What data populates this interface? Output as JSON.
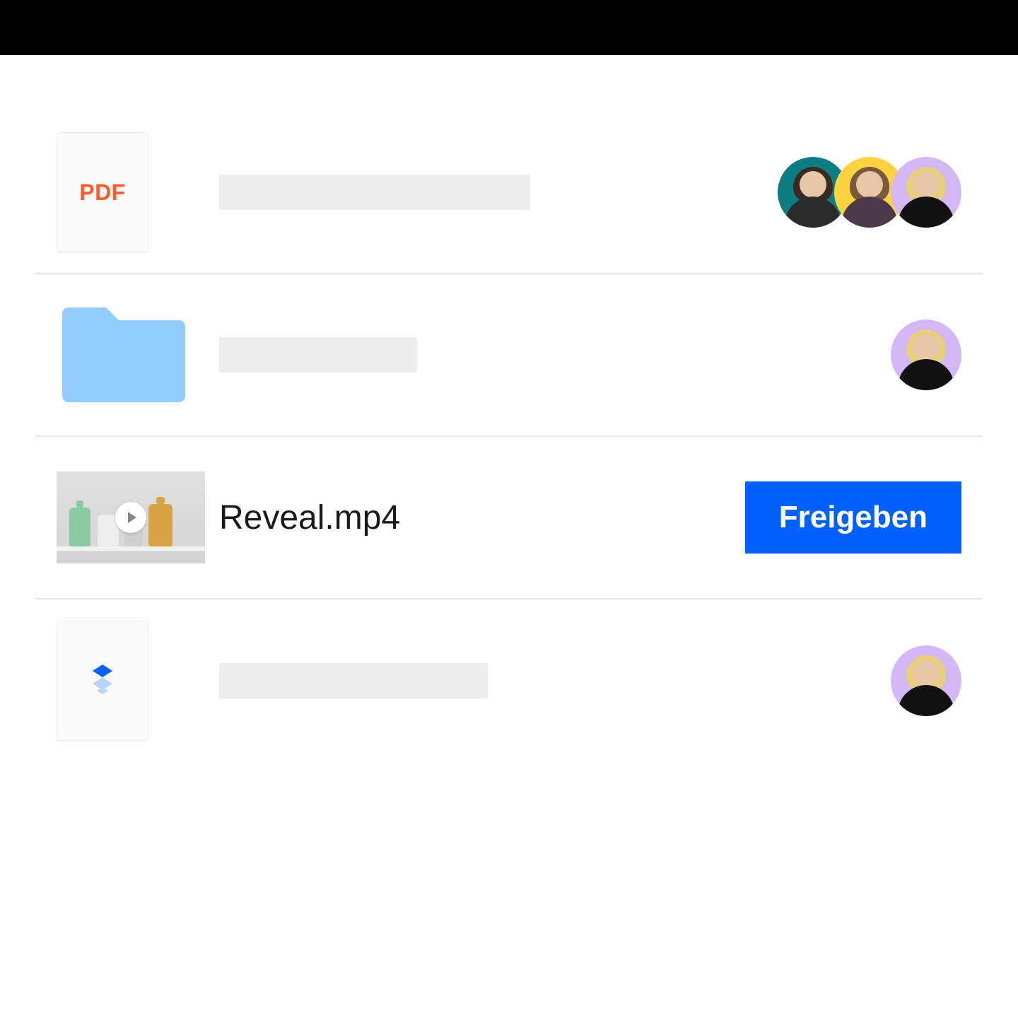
{
  "colors": {
    "accent": "#0061fe",
    "pdf_label": "#ff5b2e",
    "folder": "#92ccff",
    "avatar_teal": "#0d7d84",
    "avatar_yellow": "#ffd23f",
    "avatar_lilac": "#d4b8f5"
  },
  "rows": [
    {
      "type": "pdf",
      "icon_label": "PDF",
      "name_placeholder": true,
      "avatars": [
        "teal",
        "yellow",
        "lilac"
      ]
    },
    {
      "type": "folder",
      "name_placeholder": true,
      "avatars": [
        "lilac"
      ]
    },
    {
      "type": "video",
      "name": "Reveal.mp4",
      "share_label": "Freigeben"
    },
    {
      "type": "dropbox",
      "name_placeholder": true,
      "avatars": [
        "lilac"
      ]
    }
  ]
}
